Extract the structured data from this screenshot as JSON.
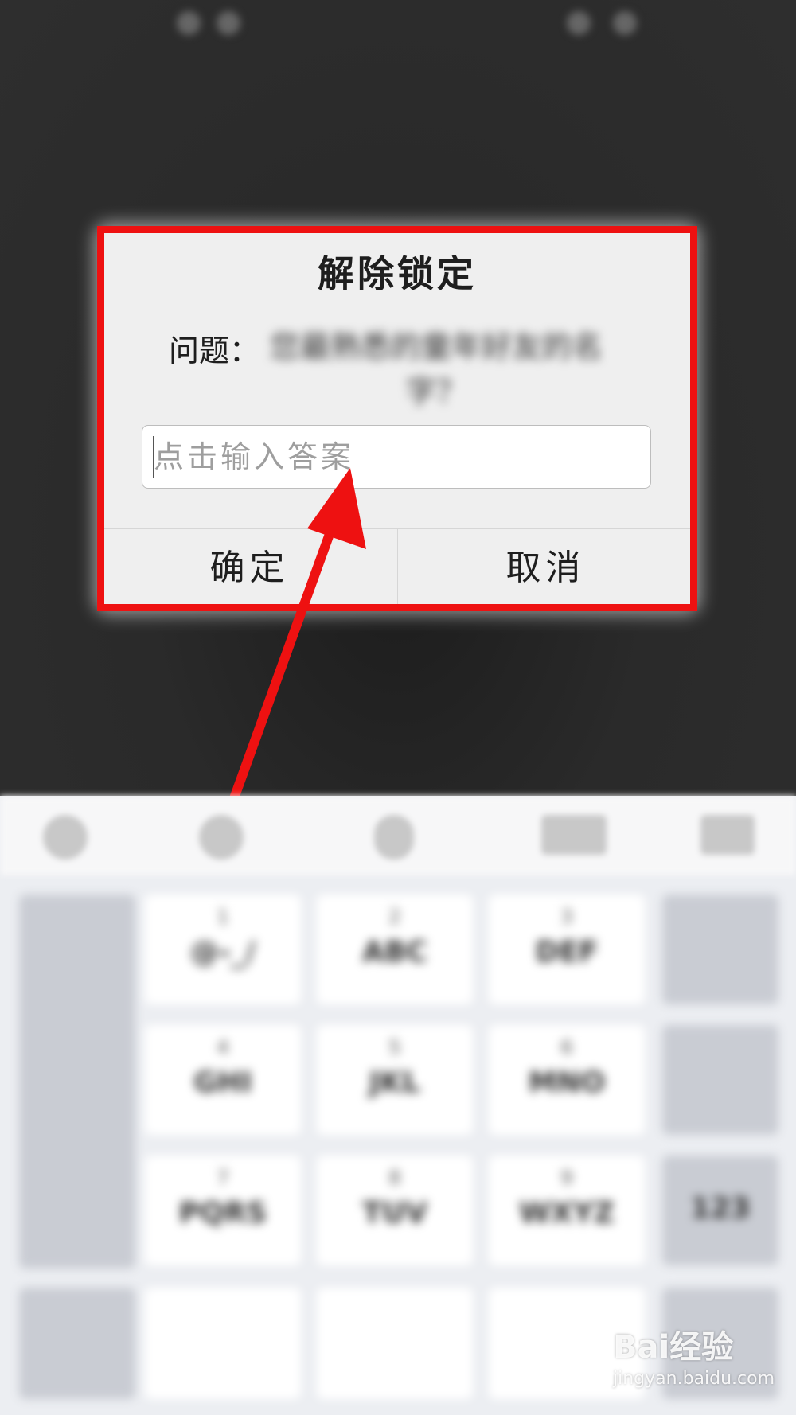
{
  "dialog": {
    "title": "解除锁定",
    "question_label": "问题：",
    "question_text": "您最熟悉的童年好友的名字？",
    "answer_placeholder": "点击输入答案",
    "confirm_label": "确定",
    "cancel_label": "取消"
  },
  "keyboard": {
    "keys": [
      {
        "num": "1",
        "letters": "@-_/"
      },
      {
        "num": "2",
        "letters": "ABC"
      },
      {
        "num": "3",
        "letters": "DEF"
      },
      {
        "num": "4",
        "letters": "GHI"
      },
      {
        "num": "5",
        "letters": "JKL"
      },
      {
        "num": "6",
        "letters": "MNO"
      },
      {
        "num": "7",
        "letters": "PQRS"
      },
      {
        "num": "8",
        "letters": "TUV"
      },
      {
        "num": "9",
        "letters": "WXYZ"
      }
    ],
    "numeric_toggle": "123"
  },
  "watermark": {
    "logo": "Bai经验",
    "url": "jingyan.baidu.com"
  },
  "colors": {
    "highlight_red": "#ee1111",
    "dialog_bg": "#efefef",
    "backdrop": "#2b2b2b"
  }
}
